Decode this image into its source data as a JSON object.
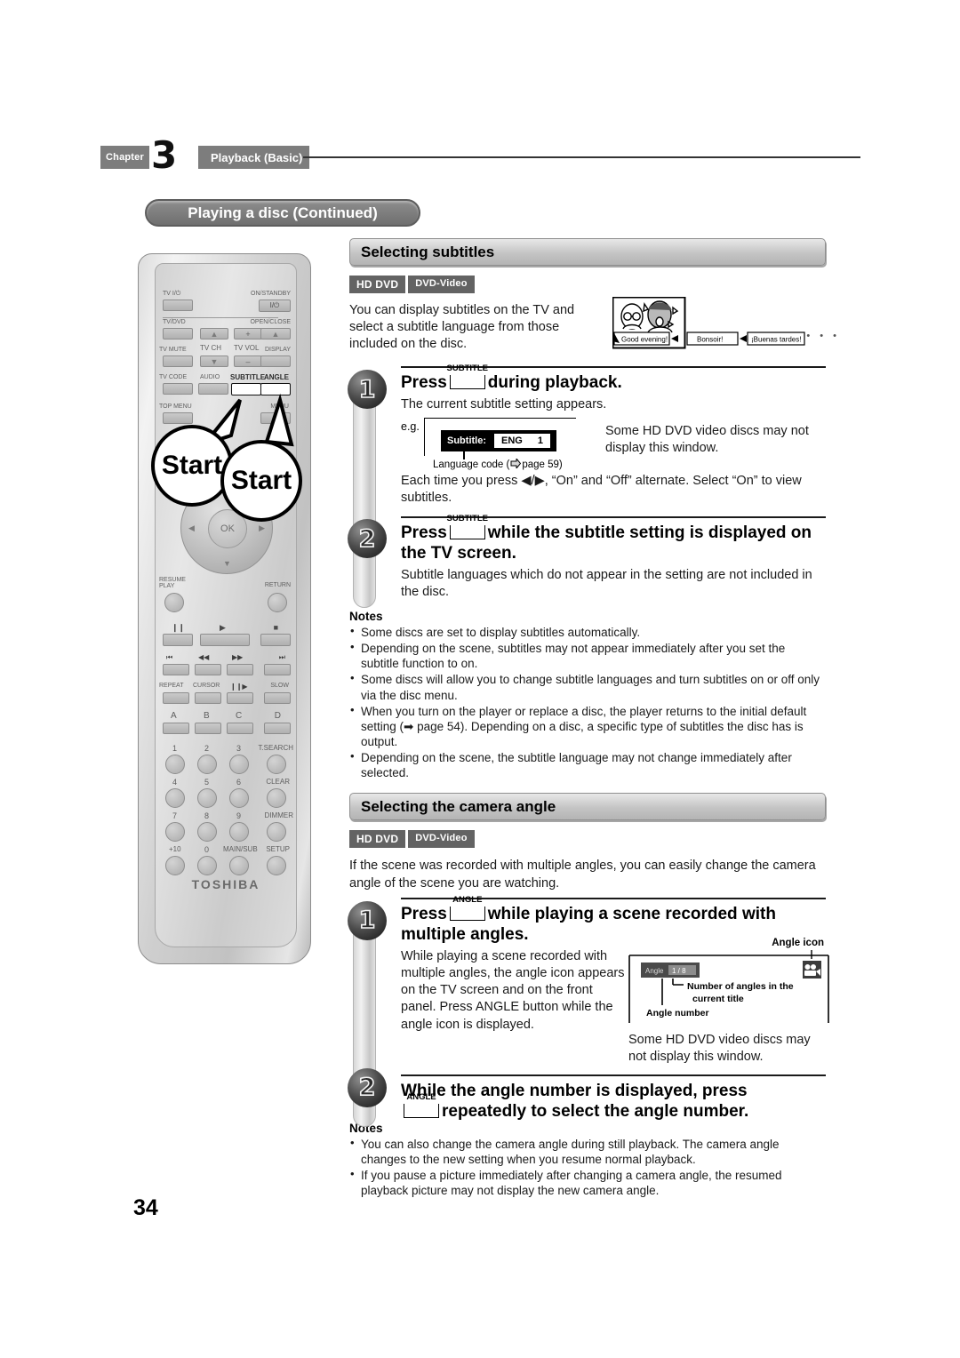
{
  "chapter": {
    "word": "Chapter",
    "number": "3",
    "title": "Playback (Basic)"
  },
  "running_head": "Playing a disc (Continued)",
  "page_number": "34",
  "remote": {
    "brand": "TOSHIBA",
    "labels": {
      "tv_power": "TV I/⏻",
      "on_standby": "ON/STANDBY",
      "on_standby_key": "I/⏻",
      "tv_dvd": "TV/DVD",
      "open_close": "OPEN/CLOSE",
      "tv_mute": "TV MUTE",
      "tv_ch": "TV CH",
      "tv_vol": "TV VOL",
      "display": "DISPLAY",
      "tv_code": "TV CODE",
      "audio": "AUDIO",
      "subtitle": "SUBTITLE",
      "angle": "ANGLE",
      "top_menu": "TOP MENU",
      "menu": "MENU",
      "ok": "OK",
      "resume_play": "RESUME\nPLAY",
      "return": "RETURN",
      "repeat": "REPEAT",
      "cursor": "CURSOR",
      "slow": "SLOW",
      "plus": "+",
      "minus": "–"
    },
    "abcd": [
      "A",
      "B",
      "C",
      "D"
    ],
    "keypad": [
      [
        "1",
        "2",
        "3",
        "T.SEARCH"
      ],
      [
        "4",
        "5",
        "6",
        "CLEAR"
      ],
      [
        "7",
        "8",
        "9",
        "DIMMER"
      ],
      [
        "+10",
        "0",
        "MAIN/SUB",
        "SETUP"
      ]
    ],
    "callouts": [
      "Start",
      "Start"
    ]
  },
  "subtitles_section": {
    "heading": "Selecting subtitles",
    "badges": [
      "HD DVD",
      "DVD-Video"
    ],
    "intro": "You can display subtitles on the TV and select a subtitle language from those included on the disc.",
    "tv_illustration": {
      "captions": [
        "Good evening!",
        "Bonsoir!",
        "¡Buenas tardes!"
      ],
      "ellipsis": "•  •  •"
    },
    "steps": [
      {
        "number": "1",
        "title_before": "Press",
        "key": "SUBTITLE",
        "title_after": "during playback.",
        "sub": "The current subtitle setting appears.",
        "eg_label": "e.g.",
        "osd": {
          "label": "Subtitle:",
          "lang": "ENG",
          "num": "1"
        },
        "osd_caption_before": "Language code (",
        "osd_caption_after": "page 59)",
        "side_note": "Some HD DVD video discs may not display this window.",
        "tail": "Each time you press ◀/▶, “On” and “Off” alternate. Select “On” to view subtitles."
      },
      {
        "number": "2",
        "title_before": "Press",
        "key": "SUBTITLE",
        "title_after": "while the subtitle setting is displayed on the TV screen.",
        "sub": "Subtitle languages which do not appear in the setting are not included in the disc."
      }
    ],
    "notes_heading": "Notes",
    "notes": [
      "Some discs are set to display subtitles automatically.",
      "Depending on the scene, subtitles may not appear immediately after you set the subtitle function to on.",
      "Some discs will allow you to change subtitle languages and turn subtitles on or off only via the disc menu.",
      "When you turn on the player or replace a disc, the player returns to the initial default setting (➡ page 54). Depending on a disc, a specific type of subtitles the disc has is output.",
      "Depending on the scene, the subtitle language may not change immediately after selected."
    ]
  },
  "angle_section": {
    "heading": "Selecting the camera angle",
    "badges": [
      "HD DVD",
      "DVD-Video"
    ],
    "intro": "If the scene was recorded with multiple angles, you can easily change the camera angle of the scene you are watching.",
    "steps": [
      {
        "number": "1",
        "title_before": "Press",
        "key": "ANGLE",
        "title_after": "while playing a scene recorded with multiple angles.",
        "sub": "While playing a scene recorded with multiple angles, the angle icon appears on the TV screen and on the front panel. Press ANGLE button while the angle icon is displayed.",
        "diagram": {
          "icon_caption": "Angle icon",
          "osd_label": "Angle",
          "osd_value": "1 / 8",
          "callout_count": "Number of angles in the current title",
          "callout_number": "Angle number"
        },
        "side_note": "Some HD DVD video discs may not display this window."
      },
      {
        "number": "2",
        "title_before": "While the angle number is displayed, press",
        "key": "ANGLE",
        "title_after": "repeatedly to select the angle number."
      }
    ],
    "notes_heading": "Notes",
    "notes": [
      "You can also change the camera angle during still playback. The camera angle changes to the new setting when you resume normal playback.",
      "If you pause a picture immediately after changing a camera angle, the resumed playback picture may not display the new camera angle."
    ]
  }
}
